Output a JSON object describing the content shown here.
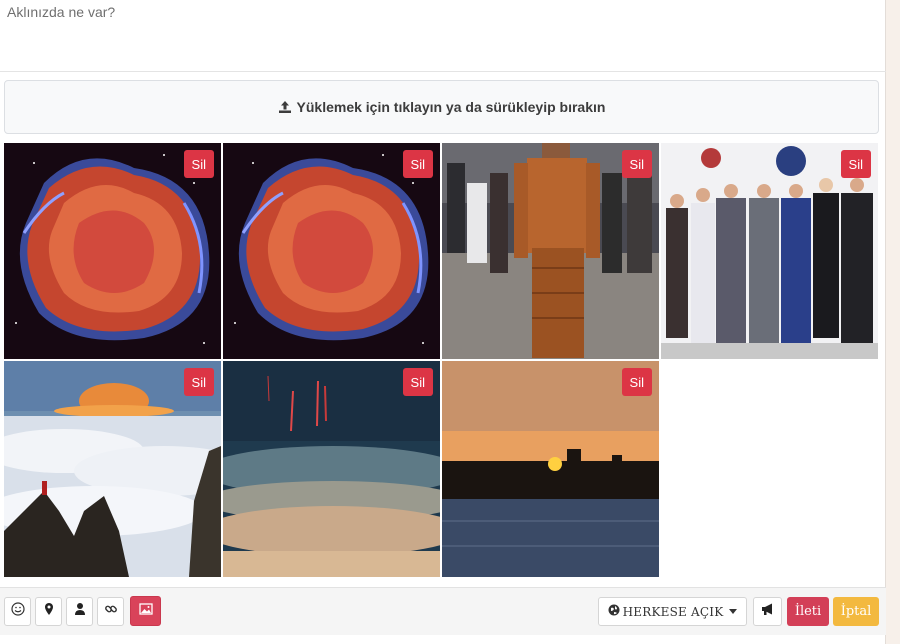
{
  "composer": {
    "placeholder": "Aklınızda ne var?"
  },
  "upload": {
    "label": "Yüklemek için tıklayın ya da sürükleyip bırakın",
    "icon": "upload-icon"
  },
  "photos": [
    {
      "name": "nebula-photo-1",
      "delete_label": "Sil"
    },
    {
      "name": "nebula-photo-2",
      "delete_label": "Sil"
    },
    {
      "name": "fashion-runway-photo",
      "delete_label": "Sil"
    },
    {
      "name": "group-event-photo",
      "delete_label": "Sil"
    },
    {
      "name": "mountain-clouds-photo",
      "delete_label": "Sil"
    },
    {
      "name": "sprites-clouds-photo",
      "delete_label": "Sil"
    },
    {
      "name": "sunset-sea-photo",
      "delete_label": "Sil"
    }
  ],
  "toolbar": {
    "icons": [
      "smile-icon",
      "location-pin-icon",
      "user-icon",
      "link-icon",
      "image-icon"
    ],
    "privacy_label": "HERKESE AÇIK",
    "post_label": "İleti",
    "cancel_label": "İptal"
  },
  "colors": {
    "delete": "#dc3545",
    "post": "#d33f57",
    "cancel": "#f3b93f",
    "image_active": "#d9435a"
  }
}
